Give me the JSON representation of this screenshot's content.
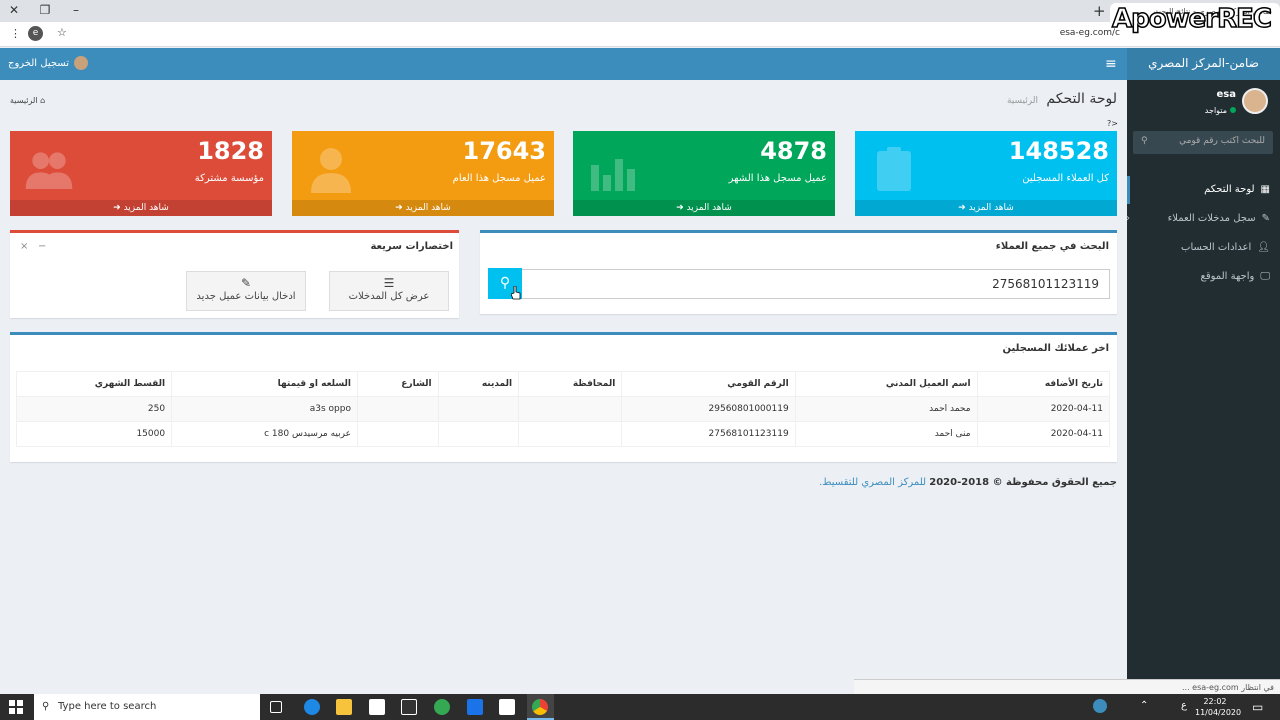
{
  "browser": {
    "tab_title": "ضامن المركز المصري - نتائج البحث",
    "url": "esa-eg.com/c",
    "watermark": "ApowerREC"
  },
  "header": {
    "brand": "ضامن-المركز المصري",
    "logout": "تسجيل الخروج"
  },
  "sidebar": {
    "user_name": "esa",
    "user_status": "متواجد",
    "search_placeholder": "للبحث اكتب رقم قومي",
    "items": [
      {
        "label": "لوحة التحكم",
        "icon": "dashboard-icon"
      },
      {
        "label": "سجل مدخلات العملاء",
        "icon": "edit-icon"
      },
      {
        "label": "اعدادات الحساب",
        "icon": "user-icon"
      },
      {
        "label": "واجهة الموقع",
        "icon": "desktop-icon"
      }
    ]
  },
  "page": {
    "title": "لوحة التحكم",
    "subtitle": "الرئيسية",
    "breadcrumb": "الرئيسية",
    "stray": "?>"
  },
  "stats": [
    {
      "value": "148528",
      "label": "كل العملاء المسجلين",
      "more": "شاهد المزيد",
      "color": "#00c0ef",
      "icon": "clipboard-icon"
    },
    {
      "value": "4878",
      "label": "عميل مسجل هذا الشهر",
      "more": "شاهد المزيد",
      "color": "#00a65a",
      "icon": "bar-chart-icon"
    },
    {
      "value": "17643",
      "label": "عميل مسجل هذا العام",
      "more": "شاهد المزيد",
      "color": "#f39c12",
      "icon": "user-icon"
    },
    {
      "value": "1828",
      "label": "مؤسسة مشتركة",
      "more": "شاهد المزيد",
      "color": "#dd4b39",
      "icon": "users-icon"
    }
  ],
  "search": {
    "title": "البحث في جميع العملاء",
    "value": "27568101123119"
  },
  "shortcuts": {
    "title": "اختصارات سريعة",
    "buttons": [
      {
        "label": "عرض كل المدخلات",
        "icon": "list-icon"
      },
      {
        "label": "ادخال بيانات عميل جديد",
        "icon": "edit-icon"
      }
    ]
  },
  "table": {
    "title": "اخر عملائك المسجلين",
    "headers": [
      "تاريخ الأضافه",
      "اسم العميل المدني",
      "الرقم القومي",
      "المحافظة",
      "المدينه",
      "الشارع",
      "السلعه او قيمتها",
      "القسط الشهري"
    ],
    "rows": [
      [
        "2020-04-11",
        "محمد احمد",
        "29560801000119",
        "",
        "",
        "",
        "a3s oppo",
        "250"
      ],
      [
        "2020-04-11",
        "منى احمد",
        "27568101123119",
        "",
        "",
        "",
        "عربيه مرسيدس 180 c",
        "15000"
      ]
    ]
  },
  "footer": {
    "text": "جميع الحقوق محفوظة © 2018-2020",
    "link": "للمركز المصري للتقسيط."
  },
  "statusbar": "في انتظار esa-eg.com ...",
  "taskbar": {
    "search": "Type here to search",
    "time": "22:02",
    "date": "11/04/2020",
    "lang": "ع"
  }
}
